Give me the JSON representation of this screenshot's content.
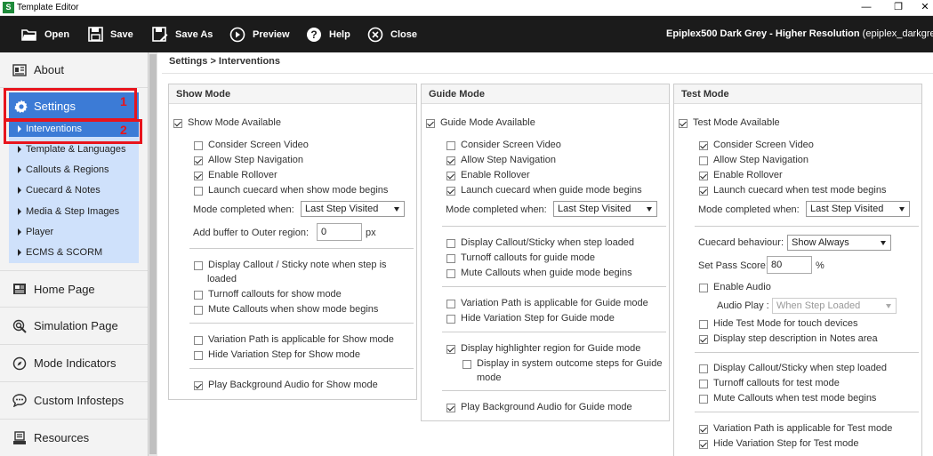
{
  "window": {
    "title": "Template Editor",
    "app_icon": "S",
    "minimize": "—",
    "restore": "❐",
    "close": "✕"
  },
  "toolbar": {
    "open": "Open",
    "save": "Save",
    "save_as": "Save As",
    "preview": "Preview",
    "help": "Help",
    "close": "Close",
    "profile_bold": "Epiplex500 Dark Grey - Higher Resolution",
    "profile_rest": " (epiplex_darkgrey"
  },
  "sidebar": {
    "about": "About",
    "settings": "Settings",
    "sub_items": [
      "Interventions",
      "Template & Languages",
      "Callouts & Regions",
      "Cuecard & Notes",
      "Media & Step Images",
      "Player",
      "ECMS & SCORM"
    ],
    "home_page": "Home Page",
    "simulation_page": "Simulation Page",
    "mode_indicators": "Mode Indicators",
    "custom_infosteps": "Custom Infosteps",
    "resources": "Resources",
    "annotation_1": "1",
    "annotation_2": "2"
  },
  "breadcrumb": "Settings > Interventions",
  "show_mode": {
    "header": "Show Mode",
    "available": "Show Mode Available",
    "consider_video": "Consider Screen Video",
    "allow_nav": "Allow Step Navigation",
    "enable_rollover": "Enable Rollover",
    "launch_cuecard": "Launch cuecard when show mode begins",
    "mode_completed_label": "Mode completed when:",
    "mode_completed_value": "Last Step Visited",
    "buffer_label": "Add buffer to Outer region:",
    "buffer_value": "0",
    "buffer_unit": "px",
    "display_callout_1": "Display Callout / Sticky note when step is",
    "display_callout_2": "loaded",
    "turnoff_callouts": "Turnoff callouts for show mode",
    "mute_callouts": "Mute Callouts when show mode begins",
    "variation_path": "Variation Path is applicable for Show mode",
    "hide_variation": "Hide Variation Step for Show mode",
    "play_audio": "Play Background Audio for Show mode"
  },
  "guide_mode": {
    "header": "Guide Mode",
    "available": "Guide Mode Available",
    "consider_video": "Consider Screen Video",
    "allow_nav": "Allow Step Navigation",
    "enable_rollover": "Enable Rollover",
    "launch_cuecard": "Launch cuecard when guide mode begins",
    "mode_completed_label": "Mode completed when:",
    "mode_completed_value": "Last Step Visited",
    "display_callout": "Display Callout/Sticky when step loaded",
    "turnoff_callouts": "Turnoff callouts for guide mode",
    "mute_callouts": "Mute Callouts when guide mode begins",
    "variation_path": "Variation Path is applicable for Guide mode",
    "hide_variation": "Hide Variation Step for Guide mode",
    "display_highlighter": "Display highlighter region for Guide mode",
    "display_system_1": "Display in system outcome steps for Guide",
    "display_system_2": "mode",
    "play_audio": "Play Background Audio for Guide mode"
  },
  "test_mode": {
    "header": "Test Mode",
    "available": "Test Mode Available",
    "consider_video": "Consider Screen Video",
    "allow_nav": "Allow Step Navigation",
    "enable_rollover": "Enable Rollover",
    "launch_cuecard": "Launch cuecard when test mode begins",
    "mode_completed_label": "Mode completed when:",
    "mode_completed_value": "Last Step Visited",
    "cuecard_label": "Cuecard behaviour:",
    "cuecard_value": "Show Always",
    "pass_score_label": "Set Pass Score:",
    "pass_score_value": "80",
    "pass_score_unit": "%",
    "enable_audio": "Enable Audio",
    "audio_play_label": "Audio Play :",
    "audio_play_value": "When Step Loaded",
    "hide_touch": "Hide Test Mode for touch devices",
    "display_step_desc": "Display step description in Notes area",
    "display_callout": "Display Callout/Sticky when step loaded",
    "turnoff_callouts": "Turnoff callouts for test mode",
    "mute_callouts": "Mute Callouts when test mode begins",
    "variation_path": "Variation Path is applicable for Test mode",
    "hide_variation": "Hide Variation Step for Test mode"
  },
  "colors": {
    "accent": "#3c7bd6",
    "toolbar": "#1b1b1b",
    "annotation": "#e8141c",
    "submenu": "#cfe1fb"
  }
}
